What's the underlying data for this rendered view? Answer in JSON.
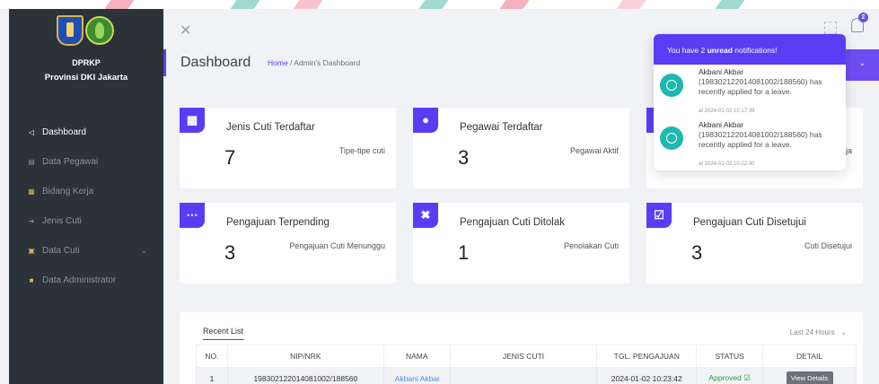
{
  "colors": {
    "accent": "#5b3cf5",
    "sidebar": "#2b323a",
    "teal": "#1db8b0",
    "link": "#4a8fd8",
    "approved": "#2e9a4a"
  },
  "sidebar": {
    "org_name": "DPRKP",
    "org_sub": "Provinsi DKI Jakarta",
    "items": [
      {
        "label": "Dashboard",
        "icon": "dashboard-icon"
      },
      {
        "label": "Data Pegawai",
        "icon": "table-icon"
      },
      {
        "label": "Bidang Kerja",
        "icon": "grid-icon"
      },
      {
        "label": "Jenis Cuti",
        "icon": "login-icon"
      },
      {
        "label": "Data Cuti",
        "icon": "calendar-icon"
      },
      {
        "label": "Data Administrator",
        "icon": "lock-icon"
      }
    ]
  },
  "header": {
    "title": "Dashboard",
    "breadcrumb_home": "Home",
    "breadcrumb_current": " / Admin's Dashboard",
    "badge_count": "2"
  },
  "cards": [
    {
      "title": "Jenis Cuti Terdaftar",
      "value": "7",
      "desc": "Tipe-tipe cuti"
    },
    {
      "title": "Pegawai Terdaftar",
      "value": "3",
      "desc": "Pegawai Aktif"
    },
    {
      "title": "",
      "value": "",
      "desc": "ja"
    },
    {
      "title": "Pengajuan Terpending",
      "value": "3",
      "desc": "Pengajuan Cuti Menunggu"
    },
    {
      "title": "Pengajuan Cuti Ditolak",
      "value": "1",
      "desc": "Penolakan Cuti"
    },
    {
      "title": "Pengajuan Cuti Disetujui",
      "value": "3",
      "desc": "Cuti Disetujui"
    }
  ],
  "notifications": {
    "head_pre": "You have 2 ",
    "head_bold": "unread",
    "head_post": " notifications!",
    "items": [
      {
        "name": "Akbani Akbar",
        "message": "(198302122014081002/188560) has recently applied for a leave.",
        "time": "at 2024-01-02 10:17:39"
      },
      {
        "name": "Akbani Akbar",
        "message": "(198302122014081002/188560) has recently applied for a leave.",
        "time": "at 2024-01-02 10:22:00"
      }
    ]
  },
  "recent": {
    "title": "Recent List",
    "filter": "Last 24 Hours",
    "columns": [
      "NO.",
      "NIP/NRK",
      "NAMA",
      "JENIS CUTI",
      "TGL. PENGAJUAN",
      "STATUS",
      "DETAIL"
    ],
    "rows": [
      {
        "no": "1",
        "nip": "198302122014081002/188560",
        "nama": "Akbani Akbar",
        "jenis": "",
        "tgl": "2024-01-02 10:23:42",
        "status": "Approved",
        "detail": "View Details"
      }
    ]
  }
}
